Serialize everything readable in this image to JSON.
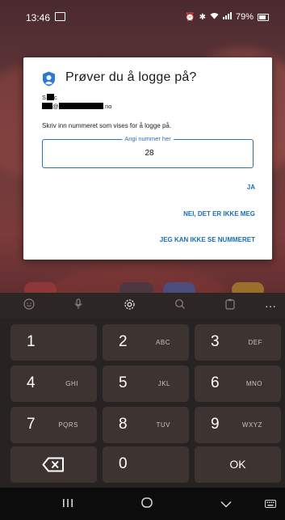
{
  "status_bar": {
    "time": "13:46",
    "battery": "79%",
    "icons": [
      "gallery-icon",
      "alarm-icon",
      "bluetooth-icon",
      "wifi-icon",
      "signal-icon",
      "battery-icon"
    ]
  },
  "dialog": {
    "icon": "authenticator-lock-icon",
    "title": "Prøver du å logge på?",
    "account_name_visible": "S",
    "account_name_tail": "c",
    "account_email_at": "@",
    "account_email_tld": ".no",
    "instruction": "Skriv inn nummeret som vises for å logge på.",
    "field_label": "Angi nummer her",
    "field_value": "28",
    "buttons": {
      "yes": "JA",
      "no": "NEI, DET ER IKKE MEG",
      "cant_see": "JEG KAN IKKE SE NUMMERET"
    },
    "accent_color": "#1a6db6"
  },
  "keyboard_toolbar": {
    "icons": [
      "emoji-icon",
      "microphone-icon",
      "settings-icon",
      "search-icon",
      "clipboard-icon",
      "more-icon"
    ],
    "more_label": "···"
  },
  "keyboard": {
    "keys": [
      {
        "num": "1",
        "letters": ""
      },
      {
        "num": "2",
        "letters": "ABC"
      },
      {
        "num": "3",
        "letters": "DEF"
      },
      {
        "num": "4",
        "letters": "GHI"
      },
      {
        "num": "5",
        "letters": "JKL"
      },
      {
        "num": "6",
        "letters": "MNO"
      },
      {
        "num": "7",
        "letters": "PQRS"
      },
      {
        "num": "8",
        "letters": "TUV"
      },
      {
        "num": "9",
        "letters": "WXYZ"
      },
      {
        "num": "0",
        "letters": ""
      }
    ],
    "ok_label": "OK",
    "delete_icon": "backspace-icon"
  },
  "nav_bar": {
    "icons": [
      "recents-icon",
      "home-icon",
      "back-icon",
      "keyboard-switch-icon"
    ]
  }
}
